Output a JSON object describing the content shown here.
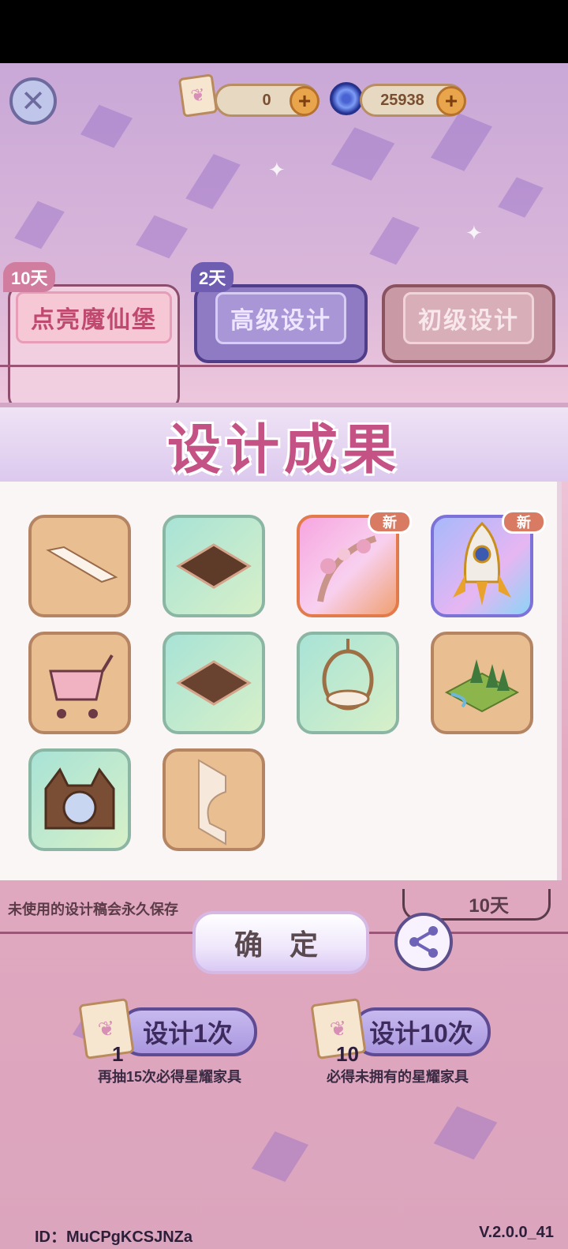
{
  "topbar": {
    "close_icon": "close-icon",
    "scroll_currency": "0",
    "gem_currency": "25938"
  },
  "tabs": [
    {
      "label": "点亮魔仙堡",
      "days": "10天"
    },
    {
      "label": "高级设计",
      "days": "2天"
    },
    {
      "label": "初级设计",
      "days": ""
    }
  ],
  "modal": {
    "title": "设计成果",
    "new_badge": "新"
  },
  "items": [
    {
      "name": "plank-item",
      "bg": "tan",
      "new": false
    },
    {
      "name": "floor-hole-item",
      "bg": "green",
      "new": false
    },
    {
      "name": "floral-arch-item",
      "bg": "pink",
      "new": true
    },
    {
      "name": "rocket-item",
      "bg": "blue",
      "new": true
    },
    {
      "name": "shopping-cart-item",
      "bg": "tan",
      "new": false
    },
    {
      "name": "floor-hole-item-2",
      "bg": "green",
      "new": false
    },
    {
      "name": "hanging-chair-item",
      "bg": "green",
      "new": false
    },
    {
      "name": "forest-terrain-item",
      "bg": "tan",
      "new": false
    },
    {
      "name": "cat-bag-item",
      "bg": "green",
      "new": false
    },
    {
      "name": "wall-panel-item",
      "bg": "tan",
      "new": false
    }
  ],
  "bottom": {
    "info_text": "未使用的设计稿会永久保存",
    "days_right": "10天",
    "confirm_label": "确 定",
    "draw1_label": "设计1次",
    "draw1_count": "1",
    "draw1_note": "再抽15次必得星耀家具",
    "draw10_label": "设计10次",
    "draw10_count": "10",
    "draw10_note": "必得未拥有的星耀家具"
  },
  "footer": {
    "id_text": "ID：MuCPgKCSJNZa",
    "version": "V.2.0.0_41"
  }
}
